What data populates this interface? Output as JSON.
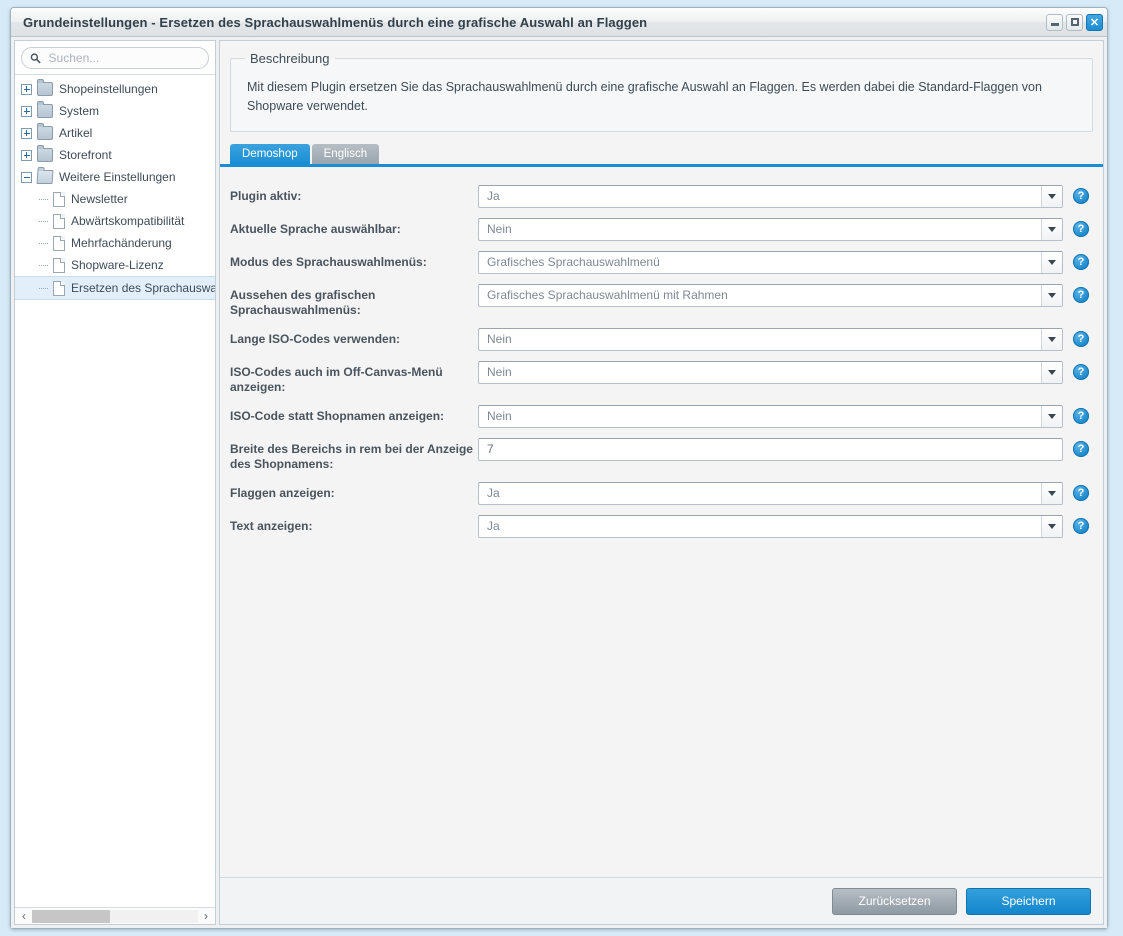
{
  "window": {
    "title": "Grundeinstellungen - Ersetzen des Sprachauswahlmenüs durch eine grafische Auswahl an Flaggen",
    "minimize_label": "",
    "maximize_label": "",
    "close_label": "✕"
  },
  "sidebar": {
    "search": {
      "placeholder": "Suchen...",
      "value": "",
      "icon": "search-icon"
    },
    "tree": [
      {
        "label": "Shopeinstellungen",
        "type": "folder",
        "expanded": false,
        "depth": 0,
        "selected": false
      },
      {
        "label": "System",
        "type": "folder",
        "expanded": false,
        "depth": 0,
        "selected": false
      },
      {
        "label": "Artikel",
        "type": "folder",
        "expanded": false,
        "depth": 0,
        "selected": false
      },
      {
        "label": "Storefront",
        "type": "folder",
        "expanded": false,
        "depth": 0,
        "selected": false
      },
      {
        "label": "Weitere Einstellungen",
        "type": "folder-open",
        "expanded": true,
        "depth": 0,
        "selected": false
      },
      {
        "label": "Newsletter",
        "type": "file",
        "depth": 1,
        "selected": false
      },
      {
        "label": "Abwärtskompatibilität",
        "type": "file",
        "depth": 1,
        "selected": false
      },
      {
        "label": "Mehrfachänderung",
        "type": "file",
        "depth": 1,
        "selected": false
      },
      {
        "label": "Shopware-Lizenz",
        "type": "file",
        "depth": 1,
        "selected": false
      },
      {
        "label": "Ersetzen des Sprachauswahlm",
        "type": "file",
        "depth": 1,
        "selected": true
      }
    ],
    "scrollbar": {
      "left_arrow": "‹",
      "right_arrow": "›"
    }
  },
  "main": {
    "description": {
      "legend": "Beschreibung",
      "text": "Mit diesem Plugin ersetzen Sie das Sprachauswahlmenü durch eine grafische Auswahl an Flaggen. Es werden dabei die Standard-Flaggen von Shopware verwendet."
    },
    "tabs": [
      {
        "label": "Demoshop",
        "active": true
      },
      {
        "label": "Englisch",
        "active": false
      }
    ],
    "fields": [
      {
        "label": "Plugin aktiv:",
        "value": "Ja",
        "control": "select",
        "help": "?"
      },
      {
        "label": "Aktuelle Sprache auswählbar:",
        "value": "Nein",
        "control": "select",
        "help": "?"
      },
      {
        "label": "Modus des Sprachauswahlmenüs:",
        "value": "Grafisches Sprachauswahlmenü",
        "control": "select",
        "help": "?"
      },
      {
        "label": "Aussehen des grafischen Sprachauswahlmenüs:",
        "value": "Grafisches Sprachauswahlmenü mit Rahmen",
        "control": "select",
        "help": "?"
      },
      {
        "label": "Lange ISO-Codes verwenden:",
        "value": "Nein",
        "control": "select",
        "help": "?"
      },
      {
        "label": "ISO-Codes auch im Off-Canvas-Menü anzeigen:",
        "value": "Nein",
        "control": "select",
        "help": "?"
      },
      {
        "label": "ISO-Code statt Shopnamen anzeigen:",
        "value": "Nein",
        "control": "select",
        "help": "?"
      },
      {
        "label": "Breite des Bereichs in rem bei der Anzeige des Shopnamens:",
        "value": "7",
        "control": "text",
        "help": "?"
      },
      {
        "label": "Flaggen anzeigen:",
        "value": "Ja",
        "control": "select",
        "help": "?"
      },
      {
        "label": "Text anzeigen:",
        "value": "Ja",
        "control": "select",
        "help": "?"
      }
    ],
    "footer": {
      "reset_label": "Zurücksetzen",
      "save_label": "Speichern"
    }
  },
  "colors": {
    "accent": "#1a8ed4",
    "desktop": "#d6eaf7",
    "panel": "#f4f4f4",
    "selected_row": "#e2effa"
  }
}
